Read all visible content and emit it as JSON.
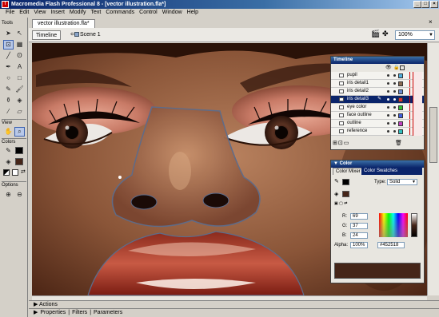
{
  "window": {
    "title": "Macromedia Flash Professional 8 - [vector illustration.fla*]",
    "controls": [
      "_",
      "□",
      "×"
    ]
  },
  "menu": [
    "File",
    "Edit",
    "View",
    "Insert",
    "Modify",
    "Text",
    "Commands",
    "Control",
    "Window",
    "Help"
  ],
  "tools": {
    "heading": "Tools",
    "view_heading": "View",
    "colors_heading": "Colors",
    "options_heading": "Options"
  },
  "document": {
    "tab": "vector illustration.fla*",
    "timeline_button": "Timeline",
    "scene": "Scene 1",
    "zoom": "100%"
  },
  "timeline": {
    "title": "Timeline",
    "layers": [
      {
        "name": "pupil",
        "color": "#4fb0e0",
        "selected": false
      },
      {
        "name": "iris detail1",
        "color": "#8a6a52",
        "selected": false
      },
      {
        "name": "iris detail2",
        "color": "#6a8ad0",
        "selected": false
      },
      {
        "name": "iris detail3",
        "color": "#e03030",
        "selected": true
      },
      {
        "name": "eye color",
        "color": "#30c030",
        "selected": false
      },
      {
        "name": "face outline",
        "color": "#4060e0",
        "selected": false
      },
      {
        "name": "outline",
        "color": "#c040c0",
        "selected": false
      },
      {
        "name": "reference",
        "color": "#30c0c0",
        "selected": false
      }
    ]
  },
  "color_panel": {
    "title": "Color",
    "tab_mixer": "Color Mixer",
    "tab_swatches": "Color Swatches",
    "type_label": "Type:",
    "type_value": "Solid",
    "r_label": "R:",
    "r_value": "69",
    "g_label": "G:",
    "g_value": "37",
    "b_label": "B:",
    "b_value": "24",
    "alpha_label": "Alpha:",
    "alpha_value": "100%",
    "hex_value": "#452518",
    "swatch_color": "#452518"
  },
  "bottom": {
    "actions": "Actions",
    "properties": "Properties",
    "filters": "Filters",
    "parameters": "Parameters"
  }
}
